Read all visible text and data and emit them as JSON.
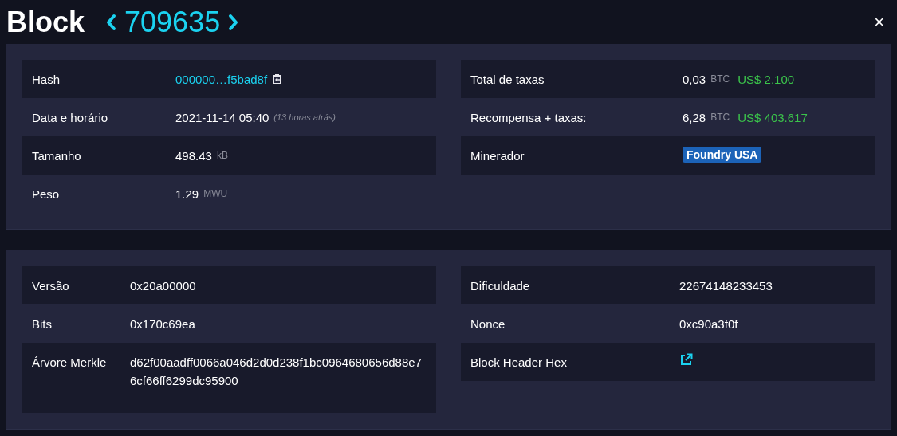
{
  "header": {
    "title": "Block",
    "block_number": "709635",
    "close": "×"
  },
  "panels": [
    {
      "columns": [
        [
          {
            "kind": "hash",
            "label": "Hash",
            "value": "000000…f5bad8f"
          },
          {
            "kind": "note",
            "label": "Data e horário",
            "value": "2021-11-14 05:40",
            "note": "(13 horas atrás)"
          },
          {
            "kind": "unit",
            "label": "Tamanho",
            "value": "498.43",
            "unit": "kB"
          },
          {
            "kind": "unit",
            "label": "Peso",
            "value": "1.29",
            "unit": "MWU"
          }
        ],
        [
          {
            "kind": "amount",
            "label": "Total de taxas",
            "value": "0,03",
            "unit": "BTC",
            "fiat": "US$ 2.100"
          },
          {
            "kind": "amount",
            "label": "Recompensa + taxas:",
            "value": "6,28",
            "unit": "BTC",
            "fiat": "US$ 403.617"
          },
          {
            "kind": "badge",
            "label": "Minerador",
            "value": "Foundry USA"
          }
        ]
      ]
    },
    {
      "columns": [
        [
          {
            "kind": "text",
            "label": "Versão",
            "value": "0x20a00000"
          },
          {
            "kind": "text",
            "label": "Bits",
            "value": "0x170c69ea"
          },
          {
            "kind": "wrap",
            "label": "Árvore Merkle",
            "value": "d62f00aadff0066a046d2d0d238f1bc0964680656d88e76cf66ff6299dc95900"
          }
        ],
        [
          {
            "kind": "text",
            "label": "Dificuldade",
            "value": "22674148233453"
          },
          {
            "kind": "text",
            "label": "Nonce",
            "value": "0xc90a3f0f"
          },
          {
            "kind": "external",
            "label": "Block Header Hex"
          }
        ]
      ]
    }
  ]
}
